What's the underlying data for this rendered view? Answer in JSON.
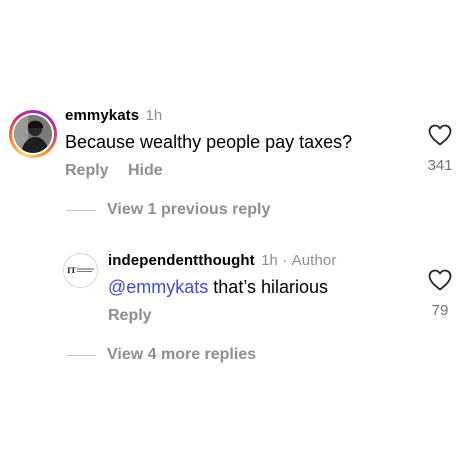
{
  "comment": {
    "username": "emmykats",
    "time": "1h",
    "text": "Because wealthy people pay taxes?",
    "reply_label": "Reply",
    "hide_label": "Hide",
    "like_count": "341"
  },
  "thread": {
    "view_previous": "View 1 previous reply",
    "view_more": "View 4 more replies"
  },
  "reply": {
    "username": "independentthought",
    "time": "1h",
    "separator": "·",
    "author_badge": "Author",
    "mention": "@emmykats",
    "text": " that’s hilarious",
    "reply_label": "Reply",
    "like_count": "79",
    "avatar_logo_text": "INDEPENDENT"
  },
  "colors": {
    "secondary_text": "#8e8e8e",
    "mention": "#3a4ed6",
    "divider": "#c7c7c7"
  },
  "icons": {
    "like": "heart-outline-icon"
  }
}
